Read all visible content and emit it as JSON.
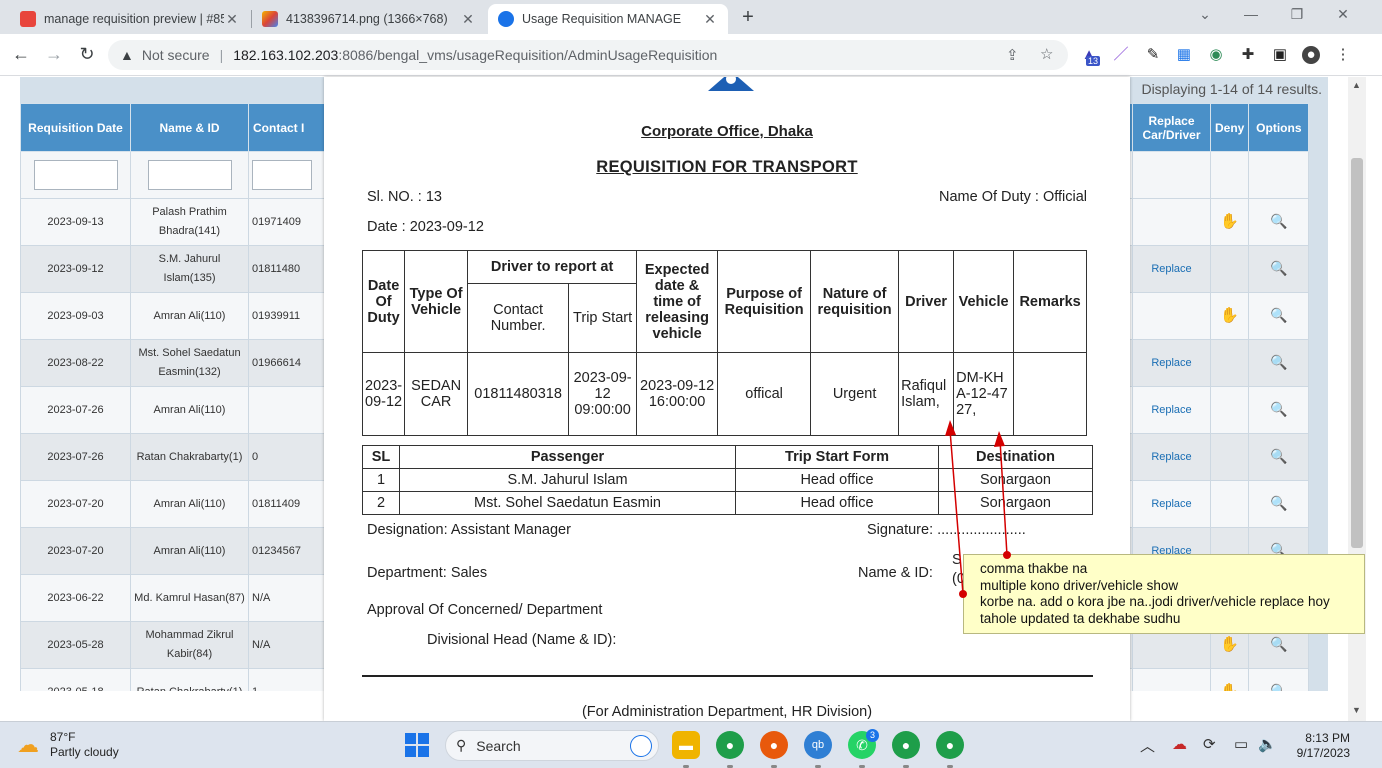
{
  "browser": {
    "tabs": [
      {
        "title": "manage requisition preview | #85",
        "close": "✕"
      },
      {
        "title": "4138396714.png (1366×768)",
        "close": "✕"
      },
      {
        "title": "Usage Requisition MANAGE",
        "close": "✕"
      }
    ],
    "new_tab": "+",
    "url_security": "Not secure",
    "url_host": "182.163.102.203",
    "url_path": ":8086/bengal_vms/usageRequisition/AdminUsageRequisition",
    "ext_badge": "13"
  },
  "grid": {
    "summary": "Displaying 1-14 of 14 results.",
    "headers": [
      "Requisition Date",
      "Name & ID",
      "Contact I"
    ],
    "right_headers": [
      "d",
      "Replace Car/Driver",
      "Deny",
      "Options"
    ],
    "replace_label": "Replace",
    "rows": [
      {
        "date": "2023-09-13",
        "name": "Palash Prathim Bhadra(141)",
        "contact": "01971409",
        "edge": "s",
        "replace": false,
        "deny": true
      },
      {
        "date": "2023-09-12",
        "name": "S.M. Jahurul Islam(135)",
        "contact": "01811480",
        "edge": "",
        "replace": true,
        "deny": false
      },
      {
        "date": "2023-09-03",
        "name": "Amran Ali(110)",
        "contact": "01939911",
        "edge": "s",
        "replace": false,
        "deny": true
      },
      {
        "date": "2023-08-22",
        "name": "Mst. Sohel Saedatun Easmin(132)",
        "contact": "01966614",
        "edge": "",
        "replace": true,
        "deny": false
      },
      {
        "date": "2023-07-26",
        "name": "Amran Ali(110)",
        "contact": "",
        "edge": "",
        "replace": true,
        "deny": false
      },
      {
        "date": "2023-07-26",
        "name": "Ratan Chakrabarty(1)",
        "contact": "0",
        "edge": "",
        "replace": true,
        "deny": false
      },
      {
        "date": "2023-07-20",
        "name": "Amran Ali(110)",
        "contact": "01811409",
        "edge": "",
        "replace": true,
        "deny": false
      },
      {
        "date": "2023-07-20",
        "name": "Amran Ali(110)",
        "contact": "01234567",
        "edge": "",
        "replace": true,
        "deny": false
      },
      {
        "date": "2023-06-22",
        "name": "Md. Kamrul Hasan(87)",
        "contact": "N/A",
        "edge": "",
        "replace": false,
        "deny": false
      },
      {
        "date": "2023-05-28",
        "name": "Mohammad Zikrul Kabir(84)",
        "contact": "N/A",
        "edge": "s",
        "replace": false,
        "deny": true
      },
      {
        "date": "2023-05-18",
        "name": "Ratan Chakrabarty(1)",
        "contact": "1",
        "edge": "",
        "replace": false,
        "deny": true
      }
    ]
  },
  "modal": {
    "office": "Corporate Office, Dhaka",
    "title": "REQUISITION FOR TRANSPORT",
    "sl_no": "Sl. NO. : 13",
    "name_of_duty": "Name Of Duty : Official",
    "date": "Date : 2023-09-12",
    "table": {
      "h_date": "Date Of Duty",
      "h_type": "Type Of Vehicle",
      "h_driver_report": "Driver to report at",
      "h_contact": "Contact Number.",
      "h_trip_start": "Trip Start",
      "h_expected": "Expected date & time of releasing vehicle",
      "h_purpose": "Purpose of Requisition",
      "h_nature": "Nature of requisition",
      "h_driver": "Driver",
      "h_vehicle": "Vehicle",
      "h_remarks": "Remarks",
      "row": {
        "date": "2023-09-12",
        "type": "SEDAN CAR",
        "contact": "01811480318",
        "trip_start": "2023-09-12 09:00:00",
        "expected": "2023-09-12 16:00:00",
        "purpose": "offical",
        "nature": "Urgent",
        "driver": "Rafiqul Islam,",
        "vehicle": "DM-KHA-12-4727,",
        "remarks": ""
      }
    },
    "passengers": {
      "headers": [
        "SL",
        "Passenger",
        "Trip Start Form",
        "Destination"
      ],
      "rows": [
        {
          "sl": "1",
          "name": "S.M. Jahurul Islam",
          "from": "Head office",
          "dest": "Sonargaon"
        },
        {
          "sl": "2",
          "name": "Mst. Sohel Saedatun Easmin",
          "from": "Head office",
          "dest": "Sonargaon"
        }
      ]
    },
    "designation": "Designation: Assistant Manager",
    "signature": "Signature: ......................",
    "department": "Department: Sales",
    "name_id": "Name & ID:",
    "name_id_partial": "S",
    "name_id_partial2": "(0",
    "approval": "Approval Of Concerned/ Department",
    "divisional_head": "Divisional Head (Name & ID):",
    "admin_note": "(For Administration Department, HR Division)"
  },
  "annotation": {
    "lines": [
      "comma thakbe na",
      "multiple kono driver/vehicle show",
      "korbe na. add o kora jbe na..jodi driver/vehicle replace hoy",
      "tahole updated ta dekhabe sudhu"
    ]
  },
  "taskbar": {
    "temp": "87°F",
    "weather": "Partly cloudy",
    "search": "Search",
    "whatsapp_badge": "3",
    "time": "8:13 PM",
    "date": "9/17/2023"
  },
  "colors": {
    "grid_header": "#4a90c8",
    "annotation_bg": "#ffffc8",
    "annotation_arrow": "#d40000"
  }
}
